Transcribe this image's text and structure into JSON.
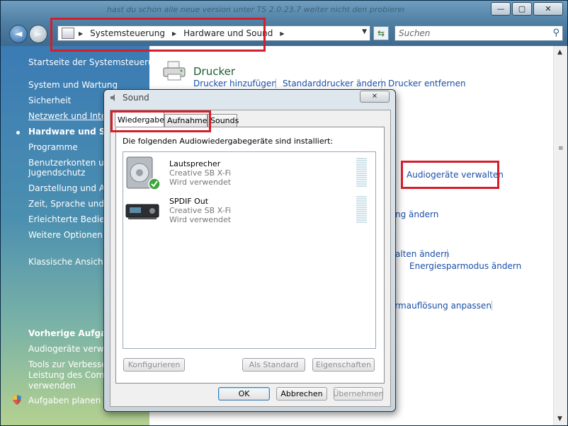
{
  "window": {
    "background_text": "hast du schon alle neue version unter TS 2.0.23.7 weiter nicht den probieren und mit den",
    "caption_buttons": {
      "minimize": "—",
      "maximize": "▢",
      "close": "✕"
    }
  },
  "navigation": {
    "back": "◄",
    "forward": "►",
    "breadcrumb": [
      "Systemsteuerung",
      "Hardware und Sound"
    ],
    "search_placeholder": "Suchen"
  },
  "sidebar": {
    "items": [
      "Startseite der Systemsteuerung",
      "System und Wartung",
      "Sicherheit",
      "Netzwerk und Intern",
      "Hardware und Sou",
      "Programme",
      "Benutzerkonten und",
      "Jugendschutz",
      "Darstellung und Anp",
      "Zeit, Sprache und Re",
      "Erleichterte Bedienu",
      "Weitere Optionen",
      "Klassische Ansicht"
    ],
    "tasks_title": "Vorherige Aufgabe",
    "tasks": [
      "Audiogeräte verwalt",
      "Tools zur Verbesser",
      "Leistung des Comp",
      "verwenden",
      "Aufgaben planen"
    ]
  },
  "main": {
    "printer_title": "Drucker",
    "printer_links": [
      "Drucker hinzufügen",
      "Standarddrucker ändern",
      "Drucker entfernen"
    ],
    "audio_link": "Audiogeräte verwalten",
    "partial_links": [
      "ng ändern",
      "alten ändern",
      "Energiesparmodus ändern",
      "irmauflösung anpassen"
    ]
  },
  "dialog": {
    "title": "Sound",
    "close": "✕",
    "tabs": [
      "Wiedergabe",
      "Aufnahme",
      "Sounds"
    ],
    "intro": "Die folgenden Audiowiedergabegeräte sind installiert:",
    "devices": [
      {
        "name": "Lautsprecher",
        "card": "Creative SB X-Fi",
        "status": "Wird verwendet"
      },
      {
        "name": "SPDIF Out",
        "card": "Creative SB X-Fi",
        "status": "Wird verwendet"
      }
    ],
    "buttons": {
      "configure": "Konfigurieren",
      "set_default": "Als Standard",
      "properties": "Eigenschaften",
      "ok": "OK",
      "cancel": "Abbrechen",
      "apply": "Übernehmen"
    }
  }
}
